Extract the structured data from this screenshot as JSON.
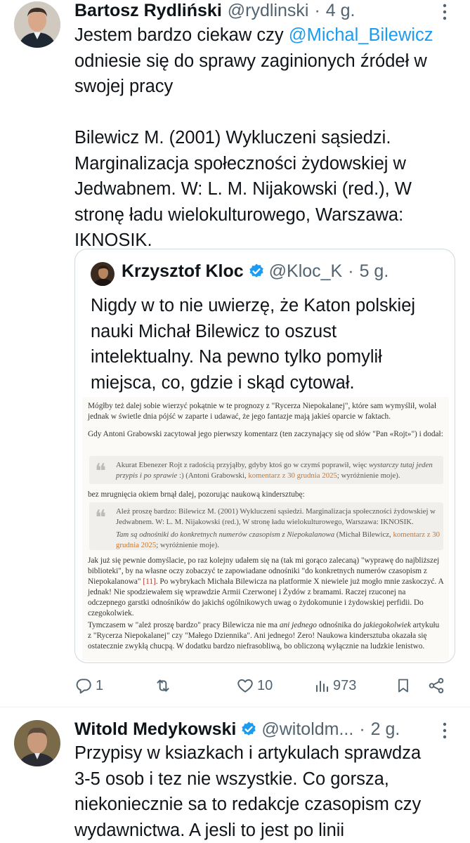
{
  "tweet1": {
    "author_name": "Bartosz Rydliński",
    "handle": "@rydlinski",
    "dot": "·",
    "time": "4 g.",
    "text_before_mention": "Jestem bardzo ciekaw czy ",
    "mention": "@Michal_Bilewicz",
    "text_after_mention": "\nodniesie się do sprawy zaginionych źródeł w\nswojej pracy\n\nBilewicz M. (2001) Wykluczeni sąsiedzi.\nMarginalizacja społeczności żydowskiej w\nJedwabnem. W: L. M. Nijakowski (red.), W\nstronę ładu wielokulturowego, Warszawa:\nIKNOSIK.",
    "quote": {
      "author_name": "Krzysztof Kloc",
      "handle": "@Kloc_K",
      "dot": "·",
      "time": "5 g.",
      "text": "Nigdy w to nie uwierzę, że Katon polskiej\nnauki Michał Bilewicz to oszust\nintelektualny. Na pewno tylko pomylił\nmiejsca, co, gdzie i skąd cytował.",
      "doc": {
        "p1": "Mógłby też dalej sobie wierzyć pokątnie w te prognozy z \"Rycerza Niepokalanej\", które sam wymyślił, wolał jednak w świetle dnia pójść w zaparte i udawać, że jego fantazje mają jakieś oparcie w faktach.",
        "p2": "Gdy Antoni Grabowski zacytował jego pierwszy komentarz (ten zaczynający się od słów \"Pan «Rojt»\") i dodał:",
        "q1_a": "Akurat Ebenezer Rojt z radością przyjąłby, gdyby ktoś go w czymś poprawił, więc ",
        "q1_em": "wystarczy tutaj jeden przypis i po sprawie",
        "q1_b": " :) (Antoni Grabowski, ",
        "q1_link": "komentarz z 30 grudnia 2025",
        "q1_c": "; wyróżnienie moje).",
        "p3": "bez mrugnięcia okiem brnął dalej, pozorując naukową kindersztubę:",
        "q2_p1": "Ależ proszę bardzo: Bilewicz M. (2001) Wykluczeni sąsiedzi. Marginalizacja społeczności żydowskiej w Jedwabnem. W: L. M. Nijakowski (red.), W stronę ładu wielokulturowego, Warszawa: IKNOSIK.",
        "q2_em": "Tam są odnośniki do konkretnych numerów czasopism z Niepokalanowa",
        "q2_b": " (Michał Bilewicz, ",
        "q2_link": "komentarz z 30 grudnia 2025",
        "q2_c": "; wyróżnienie moje).",
        "p4_a": "Jak już się pewnie domyślacie, po raz kolejny udałem się na (tak mi gorąco zalecaną) \"wyprawę do najbliższej biblioteki\", by na własne oczy zobaczyć te zapowiadane odnośniki \"do konkretnych numerów czasopism z Niepokalanowa\" ",
        "p4_ref": "[11]",
        "p4_b": ". Po wybrykach Michała Bilewicza na platformie X niewiele już mogło mnie zaskoczyć. A jednak! Nie spodziewałem się wprawdzie Armii Czerwonej i Żydów z bramami. Raczej rzuconej na odczepnego garstki odnośników do jakichś ogólnikowych uwag o żydokomunie i żydowskiej perfidii. Do czegokolwiek.",
        "p5_a": "Tymczasem w \"ależ proszę bardzo\" pracy Bilewicza nie ma ",
        "p5_em1": "ani jednego",
        "p5_b": " odnośnika do ",
        "p5_em2": "jakiegokolwiek",
        "p5_c": " artykułu z \"Rycerza Niepokalanej\" czy \"Małego Dziennika\". Ani jednego! Zero! Naukowa kindersztuba okazała się ostatecznie zwykłą chucpą. W dodatku bardzo niefrasobliwą, bo obliczoną wyłącznie na ludzkie lenistwo."
      }
    },
    "actions": {
      "replies": "1",
      "retweets": "",
      "likes": "10",
      "views": "973"
    }
  },
  "tweet2": {
    "author_name": "Witold Medykowski",
    "handle": "@witoldm...",
    "dot": "·",
    "time": "2 g.",
    "text": "Przypisy w ksiazkach i artykulach sprawdza\n3-5 osob i tez nie wszystkie. Co gorsza,\nniekoniecznie sa to redakcje czasopism czy\nwydawnictwa. A jesli to jest po linii"
  },
  "colors": {
    "accent": "#1d9bf0",
    "muted": "#536471",
    "text": "#0f1419",
    "border": "#cfd9de",
    "doc_link": "#c8742c"
  },
  "icons": [
    "avatar",
    "verified-badge-icon",
    "more-dots-icon",
    "reply-icon",
    "retweet-icon",
    "like-icon",
    "views-icon",
    "bookmark-icon",
    "share-icon"
  ]
}
